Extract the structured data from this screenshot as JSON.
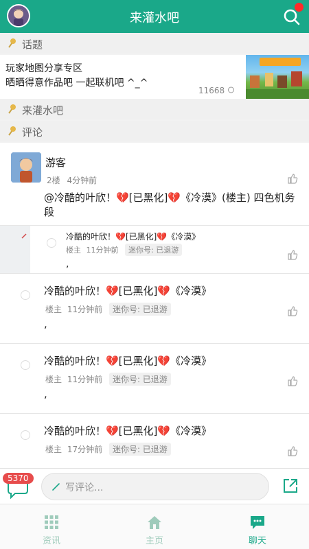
{
  "header": {
    "title": "来灌水吧",
    "search_icon": "search-icon",
    "accent": "#1aa889",
    "badge_color": "#ff2a2a"
  },
  "sections": {
    "topic": "话题",
    "forum": "来灌水吧",
    "comments": "评论"
  },
  "topic": {
    "line1": "玩家地图分享专区",
    "line2": "晒晒得意作品吧 一起联机吧 ^_^",
    "views": "11668"
  },
  "post": {
    "user": "游客",
    "floor": "2楼",
    "time": "4分钟前",
    "body": "@冷酷的叶欣！💔[已黑化]💔《冷漠》(楼主) 四色机务段"
  },
  "replies": [
    {
      "user": "冷酷的叶欣！💔[已黑化]💔《冷漠》",
      "role": "楼主",
      "time": "11分钟前",
      "tag": "迷你号: 已退游",
      "body": ","
    },
    {
      "user": "冷酷的叶欣！💔[已黑化]💔《冷漠》",
      "role": "楼主",
      "time": "11分钟前",
      "tag": "迷你号: 已退游",
      "body": ","
    },
    {
      "user": "冷酷的叶欣！💔[已黑化]💔《冷漠》",
      "role": "楼主",
      "time": "11分钟前",
      "tag": "迷你号: 已退游",
      "body": ","
    },
    {
      "user": "冷酷的叶欣！💔[已黑化]💔《冷漠》",
      "role": "楼主",
      "time": "17分钟前",
      "tag": "迷你号: 已退游",
      "body": ""
    }
  ],
  "input": {
    "count": "5370",
    "placeholder": "写评论..."
  },
  "tabs": [
    {
      "label": "资讯",
      "icon": "grid-icon"
    },
    {
      "label": "主页",
      "icon": "home-icon"
    },
    {
      "label": "聊天",
      "icon": "chat-icon"
    }
  ]
}
